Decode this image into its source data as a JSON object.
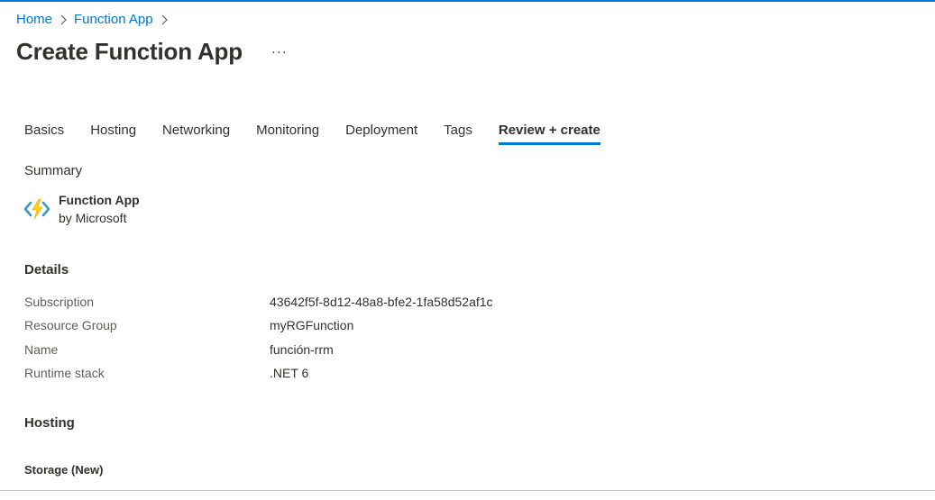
{
  "breadcrumb": {
    "items": [
      {
        "label": "Home"
      },
      {
        "label": "Function App"
      }
    ]
  },
  "header": {
    "title": "Create Function App",
    "more_label": "···"
  },
  "tabs": [
    {
      "label": "Basics",
      "active": false
    },
    {
      "label": "Hosting",
      "active": false
    },
    {
      "label": "Networking",
      "active": false
    },
    {
      "label": "Monitoring",
      "active": false
    },
    {
      "label": "Deployment",
      "active": false
    },
    {
      "label": "Tags",
      "active": false
    },
    {
      "label": "Review + create",
      "active": true
    }
  ],
  "summary": {
    "label": "Summary",
    "product_name": "Function App",
    "publisher": "by Microsoft",
    "icon": "function-app-icon"
  },
  "details": {
    "title": "Details",
    "rows": [
      {
        "key": "Subscription",
        "value": "43642f5f-8d12-48a8-bfe2-1fa58d52af1c"
      },
      {
        "key": "Resource Group",
        "value": "myRGFunction"
      },
      {
        "key": "Name",
        "value": "función-rrm"
      },
      {
        "key": "Runtime stack",
        "value": ".NET 6"
      }
    ]
  },
  "hosting": {
    "title": "Hosting",
    "storage_title": "Storage (New)"
  },
  "colors": {
    "accent": "#0078d4",
    "icon_yellow": "#fcd116",
    "icon_blue": "#3999c6"
  }
}
